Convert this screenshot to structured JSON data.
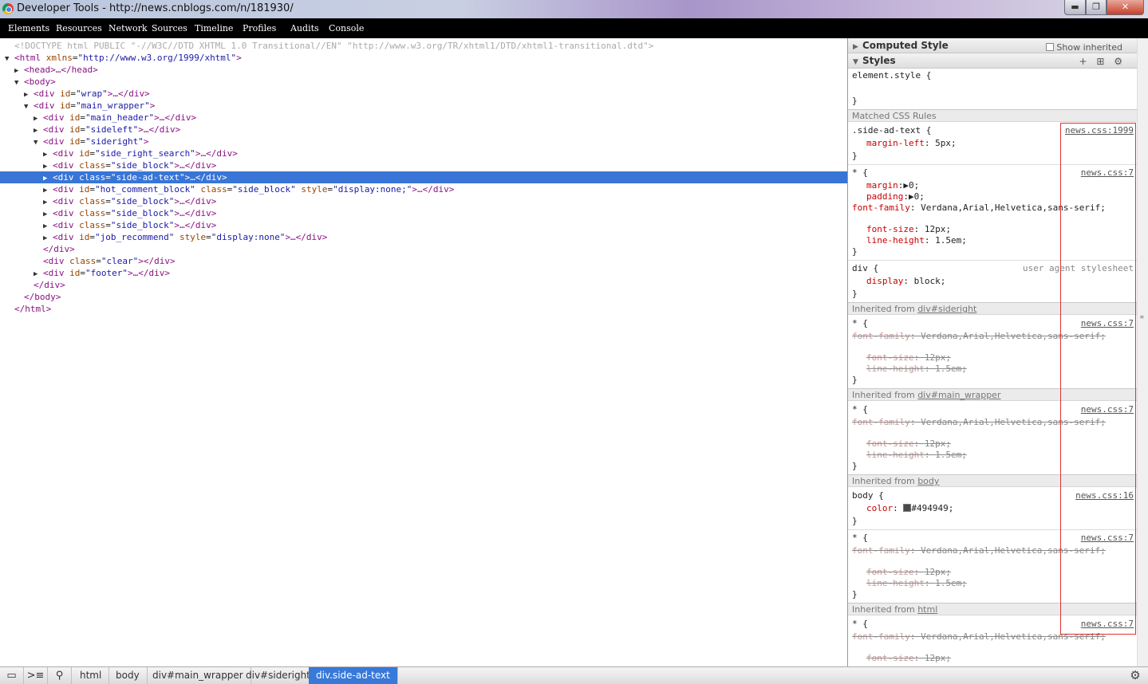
{
  "window": {
    "title": "Developer Tools - http://news.cnblogs.com/n/181930/",
    "minimize": "▬",
    "maximize": "❐",
    "close": "✕"
  },
  "tabs": [
    "Elements",
    "Resources",
    "Network",
    "Sources",
    "Timeline",
    "Profiles",
    "Audits",
    "Console"
  ],
  "dom": {
    "doctype": "<!DOCTYPE html PUBLIC \"-//W3C//DTD XHTML 1.0 Transitional//EN\" \"http://www.w3.org/TR/xhtml1/DTD/xhtml1-transitional.dtd\">",
    "lines": [
      {
        "tri": "▼",
        "open": "<html",
        "attrs": [
          {
            "n": "xmlns",
            "v": "\"http://www.w3.org/1999/xhtml\""
          }
        ],
        "close": ">"
      },
      {
        "tri": "▶",
        "open": "<head>",
        "attrs": [],
        "close": "…</head>"
      },
      {
        "tri": "▼",
        "open": "<body>",
        "attrs": [],
        "close": ""
      },
      {
        "tri": "▶",
        "open": "<div",
        "attrs": [
          {
            "n": "id",
            "v": "\"wrap\""
          }
        ],
        "close": ">…</div>"
      },
      {
        "tri": "▼",
        "open": "<div",
        "attrs": [
          {
            "n": "id",
            "v": "\"main_wrapper\""
          }
        ],
        "close": ">"
      },
      {
        "tri": "▶",
        "open": "<div",
        "attrs": [
          {
            "n": "id",
            "v": "\"main_header\""
          }
        ],
        "close": ">…</div>"
      },
      {
        "tri": "▶",
        "open": "<div",
        "attrs": [
          {
            "n": "id",
            "v": "\"sideleft\""
          }
        ],
        "close": ">…</div>"
      },
      {
        "tri": "▼",
        "open": "<div",
        "attrs": [
          {
            "n": "id",
            "v": "\"sideright\""
          }
        ],
        "close": ">"
      },
      {
        "tri": "▶",
        "open": "<div",
        "attrs": [
          {
            "n": "id",
            "v": "\"side_right_search\""
          }
        ],
        "close": ">…</div>"
      },
      {
        "tri": "▶",
        "open": "<div",
        "attrs": [
          {
            "n": "class",
            "v": "\"side_block\""
          }
        ],
        "close": ">…</div>"
      },
      {
        "tri": "▶",
        "open": "<div",
        "attrs": [
          {
            "n": "class",
            "v": "\"side-ad-text\""
          }
        ],
        "close": ">…</div>",
        "selected": true
      },
      {
        "tri": "▶",
        "open": "<div",
        "attrs": [
          {
            "n": "id",
            "v": "\"hot_comment_block\""
          },
          {
            "n": "class",
            "v": "\"side_block\""
          },
          {
            "n": "style",
            "v": "\"display:none;\""
          }
        ],
        "close": ">…</div>"
      },
      {
        "tri": "▶",
        "open": "<div",
        "attrs": [
          {
            "n": "class",
            "v": "\"side_block\""
          }
        ],
        "close": ">…</div>"
      },
      {
        "tri": "▶",
        "open": "<div",
        "attrs": [
          {
            "n": "class",
            "v": "\"side_block\""
          }
        ],
        "close": ">…</div>"
      },
      {
        "tri": "▶",
        "open": "<div",
        "attrs": [
          {
            "n": "class",
            "v": "\"side_block\""
          }
        ],
        "close": ">…</div>"
      },
      {
        "tri": "▶",
        "open": "<div",
        "attrs": [
          {
            "n": "id",
            "v": "\"job_recommend\""
          },
          {
            "n": "style",
            "v": "\"display:none\""
          }
        ],
        "close": ">…</div>"
      },
      {
        "tri": "",
        "open": "</div>",
        "attrs": [],
        "close": ""
      },
      {
        "tri": "",
        "open": "<div",
        "attrs": [
          {
            "n": "class",
            "v": "\"clear\""
          }
        ],
        "close": "></div>"
      },
      {
        "tri": "▶",
        "open": "<div",
        "attrs": [
          {
            "n": "id",
            "v": "\"footer\""
          }
        ],
        "close": ">…</div>"
      },
      {
        "tri": "",
        "open": "</div>",
        "attrs": [],
        "close": ""
      },
      {
        "tri": "",
        "open": "</body>",
        "attrs": [],
        "close": ""
      },
      {
        "tri": "",
        "open": "</html>",
        "attrs": [],
        "close": ""
      }
    ]
  },
  "sidebar": {
    "computed": "Computed Style",
    "show_inherited": "Show inherited",
    "styles": "Styles",
    "tools": [
      "+",
      "⊞",
      "⚙"
    ],
    "element_style": "element.style {",
    "brace_close": "}",
    "matched": "Matched CSS Rules",
    "rule1": {
      "selector": ".side-ad-text {",
      "src": "news.css:1999",
      "p1": "margin-left",
      "v1": "5px;"
    },
    "rule2": {
      "selector": "* {",
      "src": "news.css:7",
      "p1": "margin",
      "v1": "▶0;",
      "p2": "padding",
      "v2": "▶0;",
      "p3": "font-family",
      "v3": "Verdana,Arial,Helvetica,sans-serif;",
      "p4": "font-size",
      "v4": "12px;",
      "p5": "line-height",
      "v5": "1.5em;"
    },
    "rule3": {
      "selector": "div {",
      "src": "user agent stylesheet",
      "p1": "display",
      "v1": "block;"
    },
    "inh1": {
      "prefix": "Inherited from ",
      "link": "div#sideright"
    },
    "inh2": {
      "prefix": "Inherited from ",
      "link": "div#main_wrapper"
    },
    "inh3": {
      "prefix": "Inherited from ",
      "link": "body"
    },
    "inh4": {
      "prefix": "Inherited from ",
      "link": "html"
    },
    "star_rule": {
      "selector": "* {",
      "src": "news.css:7",
      "p1": "font-family",
      "v1": "Verdana,Arial,Helvetica,sans-serif;",
      "p2": "font-size",
      "v2": "12px;",
      "p3": "line-height",
      "v3": "1.5em;"
    },
    "body_rule": {
      "selector": "body {",
      "src": "news.css:16",
      "p1": "color",
      "v1": "#494949;",
      "swatch": "#494949"
    }
  },
  "statusbar": {
    "crumbs": [
      "html",
      "body",
      "div#main_wrapper",
      "div#sideright",
      "div.side-ad-text"
    ]
  }
}
